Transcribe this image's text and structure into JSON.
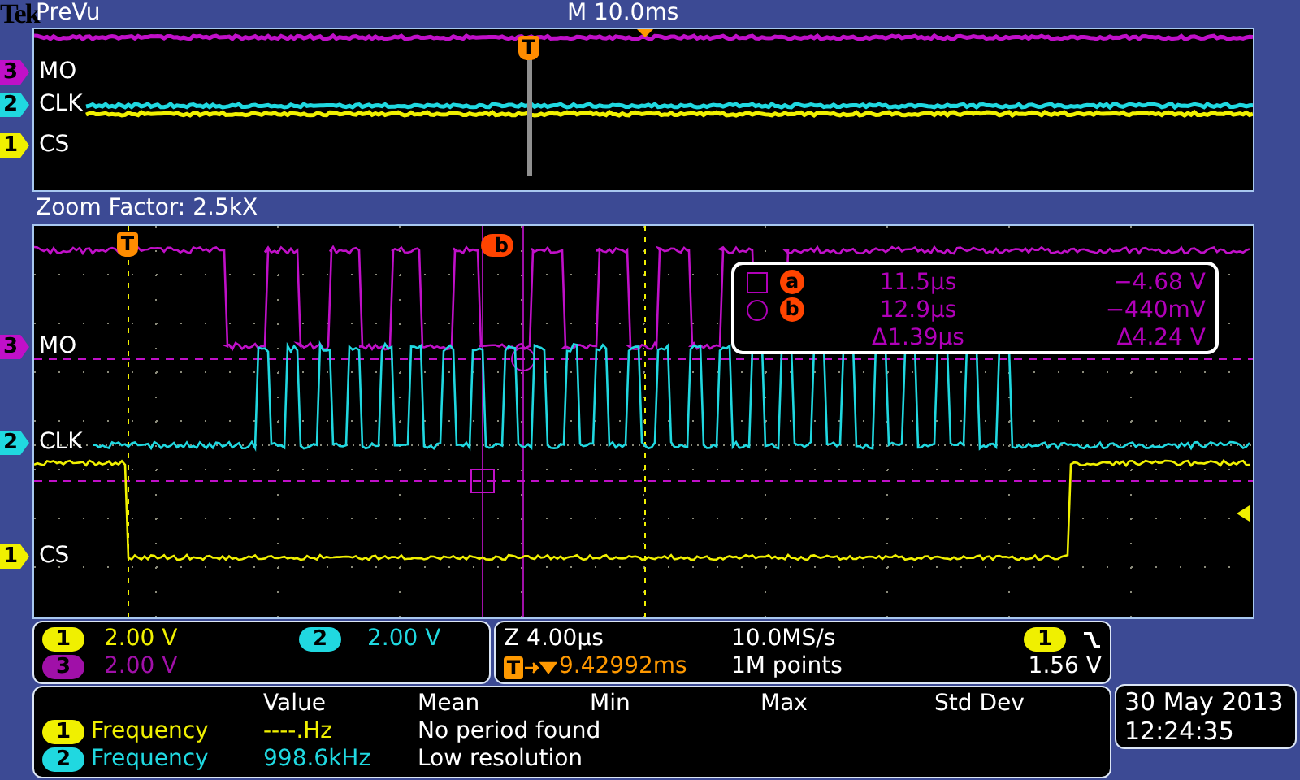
{
  "header": {
    "logo": "Tek",
    "mode": "PreVu",
    "timebase": "M 10.0ms"
  },
  "overview": {
    "trigger_marker": "T",
    "channels": [
      {
        "number": "3",
        "label": "MO",
        "color": "#c010c8"
      },
      {
        "number": "2",
        "label": "CLK",
        "color": "#20d8e0"
      },
      {
        "number": "1",
        "label": "CS",
        "color": "#f0f000"
      }
    ]
  },
  "zoom_factor": "Zoom Factor: 2.5kX",
  "zoom_view": {
    "trigger_marker": "T",
    "cursor_marker": "b",
    "channels": [
      {
        "number": "3",
        "label": "MO",
        "color": "#c010c8"
      },
      {
        "number": "2",
        "label": "CLK",
        "color": "#20d8e0"
      },
      {
        "number": "1",
        "label": "CS",
        "color": "#f0f000"
      }
    ],
    "cursor_readout": [
      {
        "kind": "square",
        "marker": "a",
        "time": "11.5µs",
        "value": "−4.68 V"
      },
      {
        "kind": "circle",
        "marker": "b",
        "time": "12.9µs",
        "value": "−440mV"
      },
      {
        "kind": "delta",
        "time": "Δ1.39µs",
        "value": "Δ4.24 V"
      }
    ]
  },
  "channel_scales": [
    {
      "number": "1",
      "scale": "2.00 V",
      "color": "#f0f000"
    },
    {
      "number": "2",
      "scale": "2.00 V",
      "color": "#20d8e0"
    },
    {
      "number": "3",
      "scale": "2.00 V",
      "color": "#a010a8"
    }
  ],
  "timebase": {
    "zoom": "Z 4.00µs",
    "sample_rate": "10.0MS/s",
    "trigger_channel": "1",
    "trigger_badge": "T",
    "trigger_position": "9.42992ms",
    "record_length": "1M points",
    "trigger_level": "1.56 V"
  },
  "measurements": {
    "columns": [
      "Value",
      "Mean",
      "Min",
      "Max",
      "Std Dev"
    ],
    "rows": [
      {
        "channel": "1",
        "color": "#f0f000",
        "name": "Frequency",
        "value": "----.Hz",
        "mean": "No period found"
      },
      {
        "channel": "2",
        "color": "#20d8e0",
        "name": "Frequency",
        "value": "998.6kHz",
        "mean": "Low resolution"
      }
    ]
  },
  "date": "30 May 2013",
  "time": "12:24:35"
}
